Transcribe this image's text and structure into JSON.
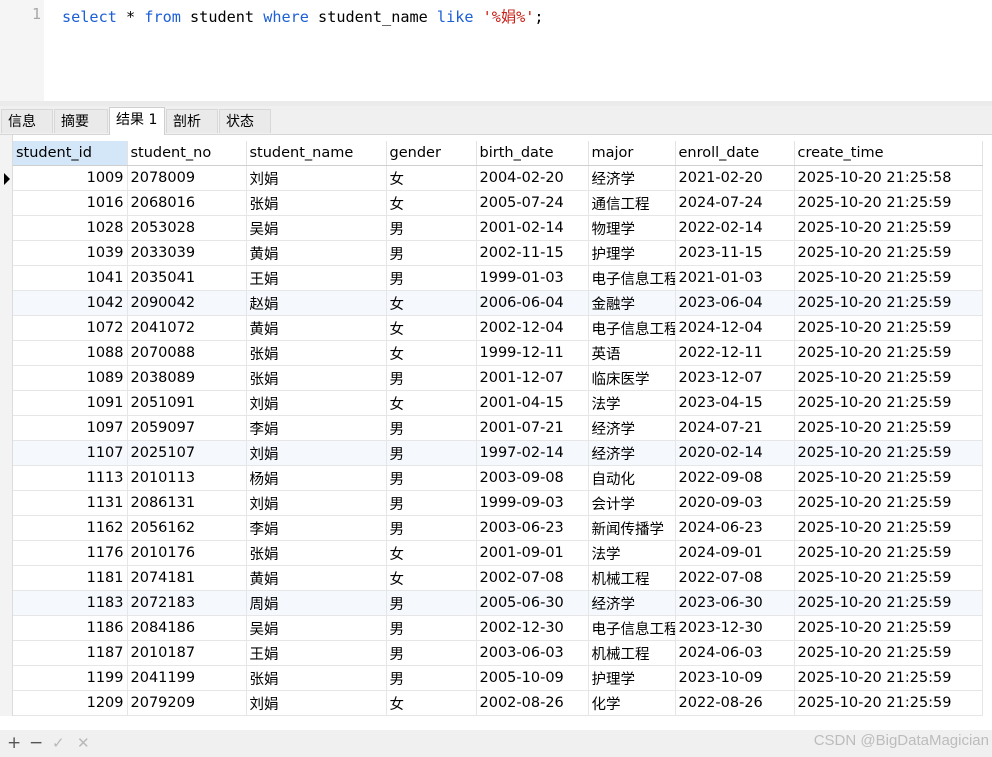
{
  "editor": {
    "line_number": "1",
    "tokens": {
      "select": "select",
      "star": " * ",
      "from": "from",
      "table": " student ",
      "where": "where",
      "column": " student_name ",
      "like": "like",
      "space": " ",
      "pattern": "'%娟%'",
      "semicolon": ";"
    }
  },
  "tabs": [
    {
      "label": "信息"
    },
    {
      "label": "摘要"
    },
    {
      "label": "结果 1"
    },
    {
      "label": "剖析"
    },
    {
      "label": "状态"
    }
  ],
  "active_tab": "结果 1",
  "columns": [
    "student_id",
    "student_no",
    "student_name",
    "gender",
    "birth_date",
    "major",
    "enroll_date",
    "create_time"
  ],
  "rows": [
    [
      "1009",
      "2078009",
      "刘娟",
      "女",
      "2004-02-20",
      "经济学",
      "2021-02-20",
      "2025-10-20 21:25:58"
    ],
    [
      "1016",
      "2068016",
      "张娟",
      "女",
      "2005-07-24",
      "通信工程",
      "2024-07-24",
      "2025-10-20 21:25:59"
    ],
    [
      "1028",
      "2053028",
      "吴娟",
      "男",
      "2001-02-14",
      "物理学",
      "2022-02-14",
      "2025-10-20 21:25:59"
    ],
    [
      "1039",
      "2033039",
      "黄娟",
      "男",
      "2002-11-15",
      "护理学",
      "2023-11-15",
      "2025-10-20 21:25:59"
    ],
    [
      "1041",
      "2035041",
      "王娟",
      "男",
      "1999-01-03",
      "电子信息工程",
      "2021-01-03",
      "2025-10-20 21:25:59"
    ],
    [
      "1042",
      "2090042",
      "赵娟",
      "女",
      "2006-06-04",
      "金融学",
      "2023-06-04",
      "2025-10-20 21:25:59"
    ],
    [
      "1072",
      "2041072",
      "黄娟",
      "女",
      "2002-12-04",
      "电子信息工程",
      "2024-12-04",
      "2025-10-20 21:25:59"
    ],
    [
      "1088",
      "2070088",
      "张娟",
      "女",
      "1999-12-11",
      "英语",
      "2022-12-11",
      "2025-10-20 21:25:59"
    ],
    [
      "1089",
      "2038089",
      "张娟",
      "男",
      "2001-12-07",
      "临床医学",
      "2023-12-07",
      "2025-10-20 21:25:59"
    ],
    [
      "1091",
      "2051091",
      "刘娟",
      "女",
      "2001-04-15",
      "法学",
      "2023-04-15",
      "2025-10-20 21:25:59"
    ],
    [
      "1097",
      "2059097",
      "李娟",
      "男",
      "2001-07-21",
      "经济学",
      "2024-07-21",
      "2025-10-20 21:25:59"
    ],
    [
      "1107",
      "2025107",
      "刘娟",
      "男",
      "1997-02-14",
      "经济学",
      "2020-02-14",
      "2025-10-20 21:25:59"
    ],
    [
      "1113",
      "2010113",
      "杨娟",
      "男",
      "2003-09-08",
      "自动化",
      "2022-09-08",
      "2025-10-20 21:25:59"
    ],
    [
      "1131",
      "2086131",
      "刘娟",
      "男",
      "1999-09-03",
      "会计学",
      "2020-09-03",
      "2025-10-20 21:25:59"
    ],
    [
      "1162",
      "2056162",
      "李娟",
      "男",
      "2003-06-23",
      "新闻传播学",
      "2024-06-23",
      "2025-10-20 21:25:59"
    ],
    [
      "1176",
      "2010176",
      "张娟",
      "女",
      "2001-09-01",
      "法学",
      "2024-09-01",
      "2025-10-20 21:25:59"
    ],
    [
      "1181",
      "2074181",
      "黄娟",
      "女",
      "2002-07-08",
      "机械工程",
      "2022-07-08",
      "2025-10-20 21:25:59"
    ],
    [
      "1183",
      "2072183",
      "周娟",
      "男",
      "2005-06-30",
      "经济学",
      "2023-06-30",
      "2025-10-20 21:25:59"
    ],
    [
      "1186",
      "2084186",
      "吴娟",
      "男",
      "2002-12-30",
      "电子信息工程",
      "2023-12-30",
      "2025-10-20 21:25:59"
    ],
    [
      "1187",
      "2010187",
      "王娟",
      "男",
      "2003-06-03",
      "机械工程",
      "2024-06-03",
      "2025-10-20 21:25:59"
    ],
    [
      "1199",
      "2041199",
      "张娟",
      "男",
      "2005-10-09",
      "护理学",
      "2023-10-09",
      "2025-10-20 21:25:59"
    ],
    [
      "1209",
      "2079209",
      "刘娟",
      "女",
      "2002-08-26",
      "化学",
      "2022-08-26",
      "2025-10-20 21:25:59"
    ]
  ],
  "bottom_toolbar": {
    "add_label": "+",
    "remove_label": "−",
    "apply_label": "✓",
    "cancel_label": "✕"
  },
  "watermark": "CSDN @BigDataMagician"
}
